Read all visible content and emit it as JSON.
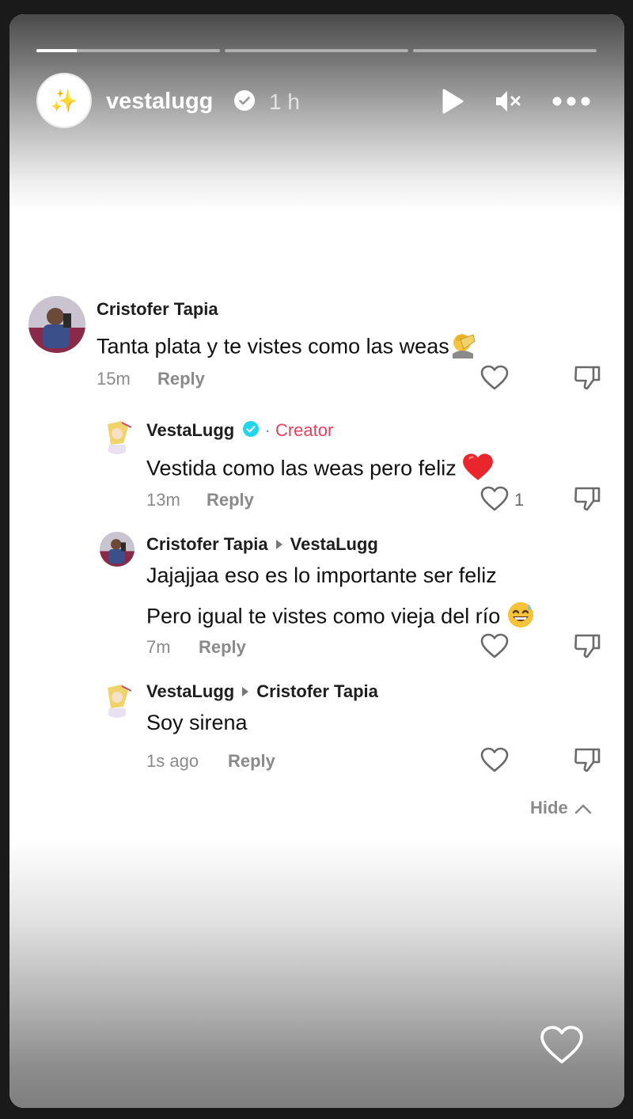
{
  "story": {
    "progress": [
      0.22,
      0,
      0
    ],
    "username": "vestalugg",
    "time": "1 h",
    "avatar_glyph": "✨"
  },
  "comments": [
    {
      "author": "Cristofer Tapia",
      "text": "Tanta plata y te vistes como las weas",
      "time": "15m",
      "reply_label": "Reply"
    },
    {
      "author": "VestaLugg",
      "creator_sep": "·",
      "creator_label": "Creator",
      "text": "Vestida como las weas pero feliz",
      "time": "13m",
      "reply_label": "Reply",
      "likes": "1"
    },
    {
      "author": "Cristofer Tapia",
      "reply_to": "VestaLugg",
      "text_line1": "Jajajjaa eso es lo importante ser feliz",
      "text_line2": "Pero igual te vistes como vieja del río",
      "time": "7m",
      "reply_label": "Reply"
    },
    {
      "author": "VestaLugg",
      "reply_to": "Cristofer Tapia",
      "text": "Soy sirena",
      "time": "1s ago",
      "reply_label": "Reply"
    }
  ],
  "hide_label": "Hide",
  "icons": [
    "verified-badge-icon",
    "play-icon",
    "mute-icon",
    "more-icon",
    "heart-icon",
    "dislike-icon",
    "chevron-up-icon"
  ],
  "colors": {
    "creator": "#e8415d",
    "verified": "#20d5ec",
    "heart_red": "#e8262c"
  }
}
